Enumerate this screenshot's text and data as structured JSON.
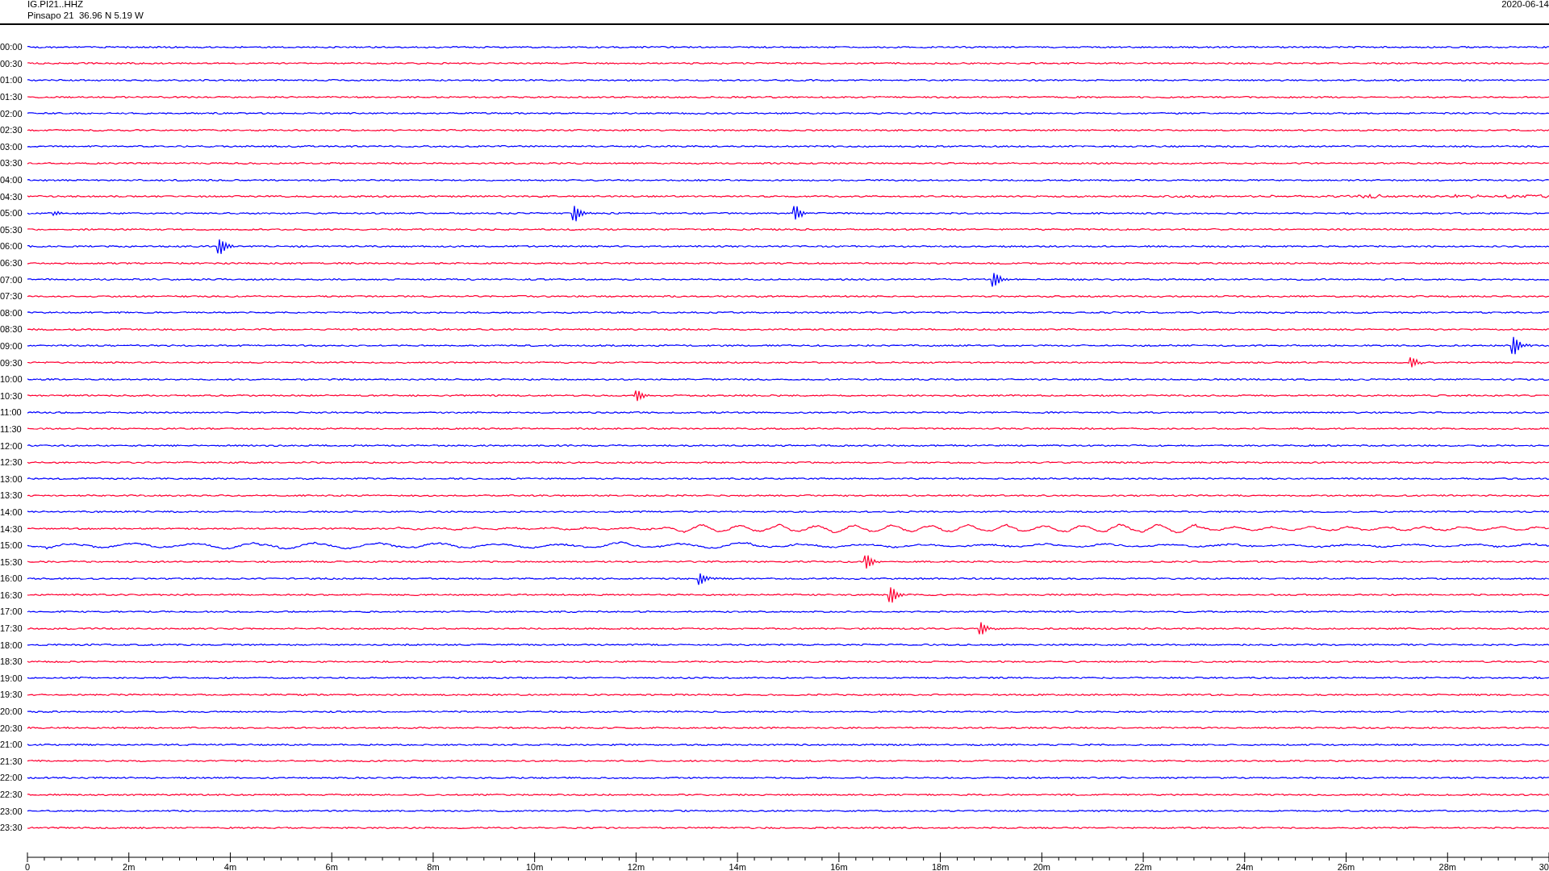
{
  "header": {
    "channel": "IG.PI21..HHZ",
    "station": "Pinsapo 21  36.96 N 5.19 W",
    "date": "2020-06-14"
  },
  "traces": [
    {
      "time": "00:00",
      "color": "#0000ff"
    },
    {
      "time": "00:30",
      "color": "#ff0033"
    },
    {
      "time": "01:00",
      "color": "#0000ff"
    },
    {
      "time": "01:30",
      "color": "#ff0033"
    },
    {
      "time": "02:00",
      "color": "#0000ff"
    },
    {
      "time": "02:30",
      "color": "#ff0033"
    },
    {
      "time": "03:00",
      "color": "#0000ff"
    },
    {
      "time": "03:30",
      "color": "#ff0033"
    },
    {
      "time": "04:00",
      "color": "#0000ff"
    },
    {
      "time": "04:30",
      "color": "#ff0033"
    },
    {
      "time": "05:00",
      "color": "#0000ff"
    },
    {
      "time": "05:30",
      "color": "#ff0033"
    },
    {
      "time": "06:00",
      "color": "#0000ff"
    },
    {
      "time": "06:30",
      "color": "#ff0033"
    },
    {
      "time": "07:00",
      "color": "#0000ff"
    },
    {
      "time": "07:30",
      "color": "#ff0033"
    },
    {
      "time": "08:00",
      "color": "#0000ff"
    },
    {
      "time": "08:30",
      "color": "#ff0033"
    },
    {
      "time": "09:00",
      "color": "#0000ff"
    },
    {
      "time": "09:30",
      "color": "#ff0033"
    },
    {
      "time": "10:00",
      "color": "#0000ff"
    },
    {
      "time": "10:30",
      "color": "#ff0033"
    },
    {
      "time": "11:00",
      "color": "#0000ff"
    },
    {
      "time": "11:30",
      "color": "#ff0033"
    },
    {
      "time": "12:00",
      "color": "#0000ff"
    },
    {
      "time": "12:30",
      "color": "#ff0033"
    },
    {
      "time": "13:00",
      "color": "#0000ff"
    },
    {
      "time": "13:30",
      "color": "#ff0033"
    },
    {
      "time": "14:00",
      "color": "#0000ff"
    },
    {
      "time": "14:30",
      "color": "#ff0033"
    },
    {
      "time": "15:00",
      "color": "#0000ff"
    },
    {
      "time": "15:30",
      "color": "#ff0033"
    },
    {
      "time": "16:00",
      "color": "#0000ff"
    },
    {
      "time": "16:30",
      "color": "#ff0033"
    },
    {
      "time": "17:00",
      "color": "#0000ff"
    },
    {
      "time": "17:30",
      "color": "#ff0033"
    },
    {
      "time": "18:00",
      "color": "#0000ff"
    },
    {
      "time": "18:30",
      "color": "#ff0033"
    },
    {
      "time": "19:00",
      "color": "#0000ff"
    },
    {
      "time": "19:30",
      "color": "#ff0033"
    },
    {
      "time": "20:00",
      "color": "#0000ff"
    },
    {
      "time": "20:30",
      "color": "#ff0033"
    },
    {
      "time": "21:00",
      "color": "#0000ff"
    },
    {
      "time": "21:30",
      "color": "#ff0033"
    },
    {
      "time": "22:00",
      "color": "#0000ff"
    },
    {
      "time": "22:30",
      "color": "#ff0033"
    },
    {
      "time": "23:00",
      "color": "#0000ff"
    },
    {
      "time": "23:30",
      "color": "#ff0033"
    }
  ],
  "x_axis": {
    "tick_labels": [
      "0",
      "2m",
      "4m",
      "6m",
      "8m",
      "10m",
      "12m",
      "14m",
      "16m",
      "18m",
      "20m",
      "22m",
      "24m",
      "26m",
      "28m",
      "30"
    ]
  }
}
